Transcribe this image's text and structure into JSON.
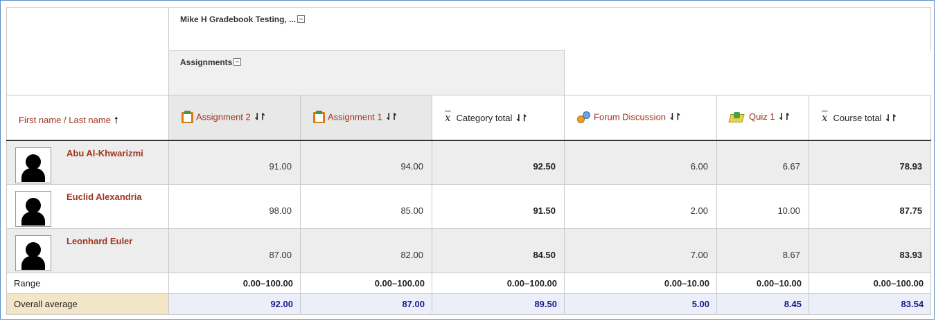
{
  "course_category": {
    "label": "Mike H Gradebook Testing, ..."
  },
  "assignments_category": {
    "label": "Assignments"
  },
  "columns": [
    {
      "label": "Assignment 2",
      "icon": "assignment-icon"
    },
    {
      "label": "Assignment 1",
      "icon": "assignment-icon"
    },
    {
      "label": "Category total",
      "icon": "x-bar-icon"
    },
    {
      "label": "Forum Discussion",
      "icon": "forum-icon"
    },
    {
      "label": "Quiz 1",
      "icon": "quiz-icon"
    },
    {
      "label": "Course total",
      "icon": "x-bar-icon"
    }
  ],
  "name_header": "First name / Last name",
  "students": [
    {
      "name": "Abu Al-Khwarizmi",
      "grades": [
        "91.00",
        "94.00",
        "92.50",
        "6.00",
        "6.67",
        "78.93"
      ]
    },
    {
      "name": "Euclid Alexandria",
      "grades": [
        "98.00",
        "85.00",
        "91.50",
        "2.00",
        "10.00",
        "87.75"
      ]
    },
    {
      "name": "Leonhard Euler",
      "grades": [
        "87.00",
        "82.00",
        "84.50",
        "7.00",
        "8.67",
        "83.93"
      ]
    }
  ],
  "range": {
    "label": "Range",
    "values": [
      "0.00–100.00",
      "0.00–100.00",
      "0.00–100.00",
      "0.00–10.00",
      "0.00–10.00",
      "0.00–100.00"
    ]
  },
  "overall_average": {
    "label": "Overall average",
    "values": [
      "92.00",
      "87.00",
      "89.50",
      "5.00",
      "8.45",
      "83.54"
    ]
  },
  "colors": {
    "link": "#a0331f",
    "average_text": "#1a1a8e",
    "average_bg": "#eceffa",
    "average_label_bg": "#f3e5c8",
    "frame": "#5b8cc8"
  }
}
